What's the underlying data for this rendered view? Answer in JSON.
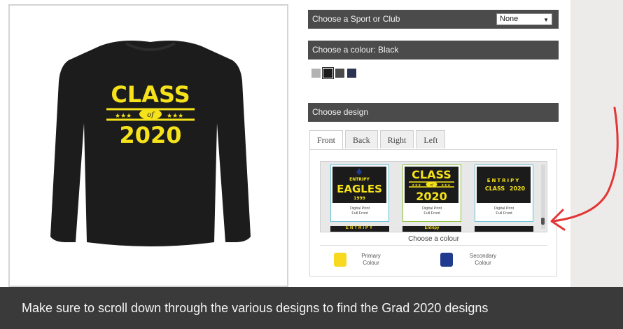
{
  "product": {
    "print_top": "CLASS",
    "print_mid": "of",
    "print_bottom": "2020",
    "colors": {
      "sweater": "#1c1c1c",
      "print": "#f5e21a"
    }
  },
  "options": {
    "sport_label": "Choose a Sport or Club",
    "sport_value": "None",
    "colour_label": "Choose a colour: Black",
    "swatches": [
      "#b3b3b3",
      "#1a1a1a",
      "#4a4a4a",
      "#2a3352"
    ],
    "design_label": "Choose design"
  },
  "tabs": [
    "Front",
    "Back",
    "Right",
    "Left"
  ],
  "designs": [
    {
      "top": "ENTRIPY",
      "main": "EAGLES",
      "sub": "1999",
      "label_1": "Digital Print",
      "label_2": "Full Front"
    },
    {
      "top": "CLASS",
      "mid": "of",
      "main": "2020",
      "label_1": "Digital Print",
      "label_2": "Full Front"
    },
    {
      "top": "ENTRIPY",
      "main": "CLASS",
      "sub": "2020",
      "label_1": "Digital Print",
      "label_2": "Full Front"
    }
  ],
  "row2": [
    "ENTRIPY",
    "Entripy",
    ""
  ],
  "colour_picker": {
    "title": "Choose a colour",
    "primary_label_1": "Primary",
    "primary_label_2": "Colour",
    "primary_color": "#f7da1f",
    "secondary_label_1": "Secondary",
    "secondary_label_2": "Colour",
    "secondary_color": "#1f3a8f"
  },
  "caption": "Make sure to scroll down through the various designs to find the Grad 2020 designs"
}
